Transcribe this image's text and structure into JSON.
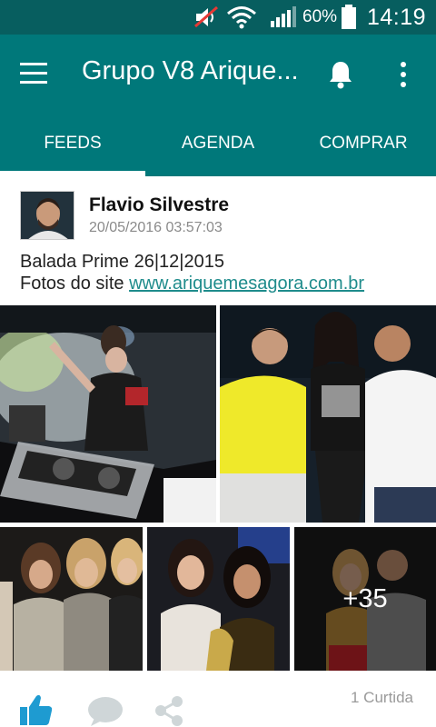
{
  "status_bar": {
    "battery_text": "60%",
    "time": "14:19",
    "icons": [
      "mute-icon",
      "wifi-icon",
      "signal-icon",
      "battery-icon"
    ]
  },
  "toolbar": {
    "title": "Grupo V8 Arique...",
    "icons": [
      "menu-icon",
      "bell-icon",
      "overflow-menu-icon"
    ]
  },
  "tabs": [
    {
      "label": "FEEDS",
      "selected": true
    },
    {
      "label": "AGENDA",
      "selected": false
    },
    {
      "label": "COMPRAR",
      "selected": false
    }
  ],
  "post": {
    "author": "Flavio Silvestre",
    "date": "20/05/2016 03:57:03",
    "text_line1": "Balada Prime 26|12|2015",
    "text_prefix": "Fotos do site ",
    "link": "www.ariquemesagora.com.br",
    "more_photos": "+35",
    "likes": "1 Curtida"
  },
  "colors": {
    "status_bar": "#075e5f",
    "app_bar": "#00787a",
    "accent": "#1f8c8c",
    "like_icon": "#1e9bd1",
    "muted_icon": "#cfd6d8"
  }
}
